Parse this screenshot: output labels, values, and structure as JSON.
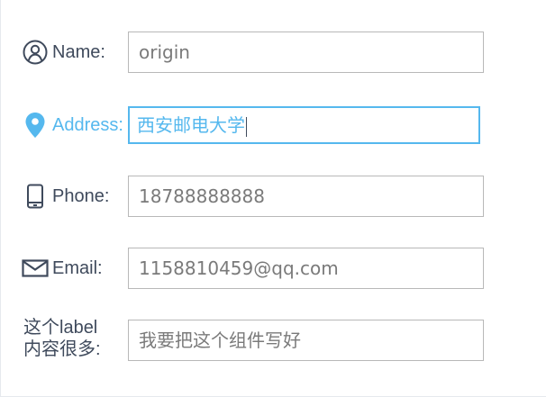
{
  "form": {
    "fields": [
      {
        "label": "Name:",
        "icon": "user-circle-icon",
        "value": "origin",
        "active": false
      },
      {
        "label": "Address:",
        "icon": "location-pin-icon",
        "value": "西安邮电大学",
        "active": true
      },
      {
        "label": "Phone:",
        "icon": "mobile-phone-icon",
        "value": "18788888888",
        "active": false
      },
      {
        "label": "Email:",
        "icon": "envelope-icon",
        "value": "1158810459@qq.com",
        "active": false
      },
      {
        "label_line1": "这个label",
        "label_line2": "内容很多:",
        "value": "我要把这个组件写好",
        "active": false
      }
    ]
  },
  "colors": {
    "label": "#3f4a5c",
    "accent": "#55b8ee",
    "input_border": "#b8b8b8",
    "input_text": "#7a7a7a"
  }
}
